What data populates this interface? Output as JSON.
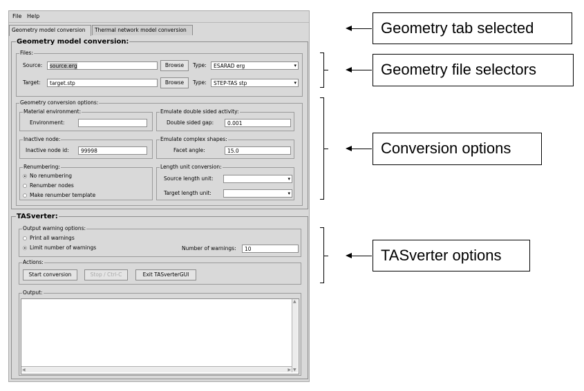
{
  "menu": {
    "file": "File",
    "help": "Help"
  },
  "tabs": [
    "Geometry model conversion",
    "Thermal network model conversion"
  ],
  "geometry": {
    "title": "Geometry model conversion:",
    "files": {
      "title": "Files:",
      "source_label": "Source:",
      "source_value": "source.erg",
      "target_label": "Target:",
      "target_value": "target.stp",
      "browse": "Browse",
      "type_label": "Type:",
      "source_type": "ESARAD erg",
      "target_type": "STEP-TAS stp"
    },
    "options": {
      "title": "Geometry conversion options:",
      "material_env": {
        "title": "Material environment:",
        "label": "Environment:",
        "value": ""
      },
      "double_sided": {
        "title": "Emulate double sided activity:",
        "label": "Double sided gap:",
        "value": "0.001"
      },
      "inactive": {
        "title": "Inactive node:",
        "label": "Inactive node id:",
        "value": "99998"
      },
      "complex": {
        "title": "Emulate complex shapes:",
        "label": "Facet angle:",
        "value": "15.0"
      },
      "renumbering": {
        "title": "Renumbering:",
        "options": [
          "No renumbering",
          "Renumber nodes",
          "Make renumber template"
        ],
        "selected": "No renumbering"
      },
      "length_unit": {
        "title": "Length unit conversion:",
        "source_label": "Source length unit:",
        "target_label": "Target length unit:",
        "source_value": "",
        "target_value": ""
      }
    }
  },
  "tasverter": {
    "title": "TASverter:",
    "warnings": {
      "title": "Output warning options:",
      "options": [
        "Print all warnings",
        "Limit number of warnings"
      ],
      "selected": "Limit number of warnings",
      "count_label": "Number of warnings:",
      "count_value": "10"
    },
    "actions": {
      "title": "Actions:",
      "start": "Start conversion",
      "stop": "Stop / Ctrl-C",
      "exit": "Exit TASverterGUI"
    },
    "output": {
      "title": "Output:",
      "text": ""
    }
  },
  "callouts": {
    "tab": "Geometry tab selected",
    "files": "Geometry file selectors",
    "conversion": "Conversion options",
    "tasverter": "TASverter options"
  }
}
